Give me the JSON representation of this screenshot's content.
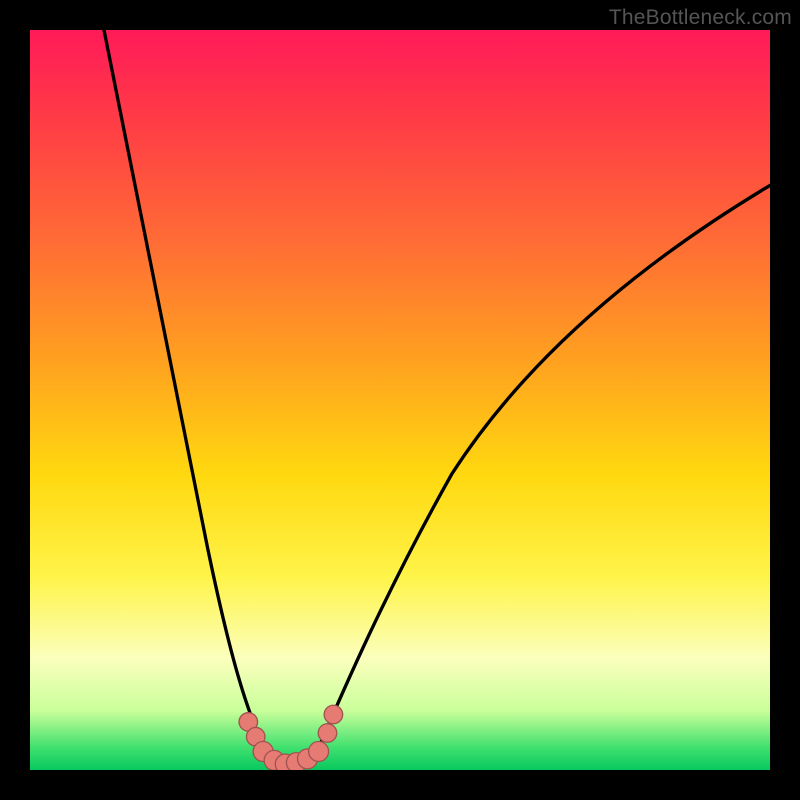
{
  "attribution": "TheBottleneck.com",
  "colors": {
    "frame": "#000000",
    "gradient_top": "#ff1a58",
    "gradient_bottom": "#07c85f",
    "curve_stroke": "#000000",
    "markers_fill": "#e67b74",
    "markers_stroke": "#a0534f"
  },
  "chart_data": {
    "type": "line",
    "title": "",
    "xlabel": "",
    "ylabel": "",
    "xlim": [
      0,
      100
    ],
    "ylim": [
      0,
      100
    ],
    "note": "No axis ticks or numeric labels are rendered; values are estimated in 0–100 plot-area percentage coordinates (0,0 = top-left).",
    "series": [
      {
        "name": "left-curve",
        "x": [
          10.0,
          12.0,
          14.0,
          16.0,
          18.0,
          20.0,
          22.0,
          24.0,
          25.5,
          27.0,
          28.5,
          30.0,
          31.0,
          32.0
        ],
        "y": [
          0.0,
          10.0,
          20.0,
          30.0,
          40.0,
          50.0,
          60.0,
          70.0,
          78.0,
          85.0,
          90.0,
          94.0,
          96.0,
          97.5
        ]
      },
      {
        "name": "trough",
        "x": [
          32.0,
          33.0,
          34.0,
          35.0,
          36.0,
          37.0,
          38.0,
          39.0
        ],
        "y": [
          97.5,
          98.5,
          99.0,
          99.2,
          99.0,
          98.5,
          98.0,
          97.0
        ]
      },
      {
        "name": "right-curve",
        "x": [
          39.0,
          41.0,
          44.0,
          48.0,
          52.0,
          57.0,
          62.0,
          68.0,
          74.0,
          80.0,
          86.0,
          92.0,
          98.0,
          100.0
        ],
        "y": [
          97.0,
          92.0,
          85.0,
          76.0,
          68.0,
          60.0,
          53.0,
          46.0,
          40.0,
          35.0,
          30.0,
          26.0,
          22.5,
          21.0
        ]
      }
    ],
    "markers": {
      "name": "trough-markers",
      "x": [
        29.5,
        30.5,
        31.5,
        33.0,
        34.5,
        36.0,
        37.5,
        39.0,
        40.2,
        41.0
      ],
      "y": [
        93.5,
        95.5,
        97.5,
        98.7,
        99.2,
        99.0,
        98.5,
        97.5,
        95.0,
        92.5
      ],
      "r": [
        1.25,
        1.25,
        1.35,
        1.35,
        1.35,
        1.35,
        1.35,
        1.35,
        1.25,
        1.25
      ]
    }
  }
}
